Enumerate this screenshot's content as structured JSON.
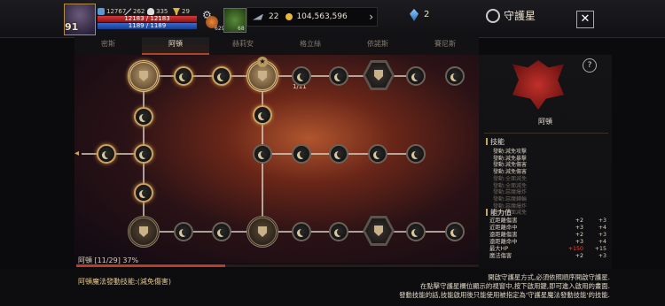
{
  "player": {
    "level": "91",
    "combat": "12767",
    "attack": "262",
    "skulls": "335",
    "trophies": "29",
    "hp": "12183 / 12183",
    "mp": "1189 / 1189",
    "potion_count": "629",
    "leaf_count": "68"
  },
  "currency": {
    "wings": "22",
    "gold": "104,563,596",
    "gems": "2"
  },
  "header": {
    "title": "守護星",
    "close": "✕"
  },
  "tabs": [
    "密斯",
    "阿頓",
    "赫莉安",
    "格立絲",
    "依諾斯",
    "賽尼斯"
  ],
  "active_tab": 1,
  "board": {
    "node_count": "1/11",
    "star": "★"
  },
  "progress": {
    "label": "阿頓 [11/29] 37%",
    "percent": 37
  },
  "footer": {
    "skill_link": "阿頓魔法發動技能:(減免傷害)",
    "hint_lines": [
      "開啟守護星方式,必須依照順序開啟守護星.",
      "在點擊守護星欄位顯示的視窗中,按下啟用鍵,即可進入啟用的畫面.",
      "發動技能的話,技能啟用後只能使用被指定為'守護星魔法發動技能'的技能."
    ]
  },
  "panel": {
    "emblem_name": "阿頓",
    "skills_title": "技能",
    "skills": [
      {
        "text": "發動:減免攻擊",
        "lit": true
      },
      {
        "text": "發動:減免暴擊",
        "lit": true
      },
      {
        "text": "發動:減免傷害",
        "lit": true
      },
      {
        "text": "發動:減免傷害",
        "lit": true
      },
      {
        "text": "發動:全面減免",
        "lit": false
      },
      {
        "text": "發動:全面減免",
        "lit": false
      },
      {
        "text": "發動:惡魔爆炸",
        "lit": false
      },
      {
        "text": "發動:惡魔轉輪",
        "lit": false
      },
      {
        "text": "發動:惡魔爆炸",
        "lit": false
      },
      {
        "text": "發動:全面減免",
        "lit": false
      }
    ],
    "stats_title": "能力值",
    "stats": [
      {
        "name": "近距離傷害",
        "a": "+2",
        "b": "+3",
        "red": false
      },
      {
        "name": "近距離命中",
        "a": "+3",
        "b": "+4",
        "red": false
      },
      {
        "name": "遠距離傷害",
        "a": "+2",
        "b": "+3",
        "red": false
      },
      {
        "name": "遠距離命中",
        "a": "+3",
        "b": "+4",
        "red": false
      },
      {
        "name": "最大HP",
        "a": "+150",
        "b": "+15",
        "red": true
      },
      {
        "name": "魔法傷害",
        "a": "+2",
        "b": "+3",
        "red": false
      }
    ]
  },
  "colors": {
    "accent": "#c9a264",
    "progress": "#c03a2a",
    "hp": "#d23a3a",
    "mp": "#3a6ad2"
  }
}
